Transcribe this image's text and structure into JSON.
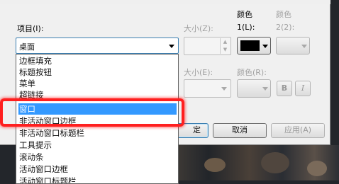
{
  "dialog": {
    "item_label": "项目(I):",
    "item_value": "桌面",
    "size1_label": "大小(Z):",
    "color1_label_line1": "颜色",
    "color1_label_line2": "1(L):",
    "color2_label_line1": "颜色",
    "color2_label_line2": "2(2):",
    "color1_value": "#000000",
    "size2_label": "大小(E):",
    "font_color_label": "颜色(R):",
    "bold_label": "B",
    "italic_label": "I",
    "ok_label": "定",
    "cancel_label": "取消",
    "apply_label": "应用(A)"
  },
  "list": {
    "items": [
      "边框填充",
      "标题按钮",
      "菜单",
      "超链接",
      "窗口",
      "非活动窗口边框",
      "非活动窗口标题栏",
      "工具提示",
      "滚动条",
      "活动窗口边框",
      "活动窗口标题栏"
    ],
    "selected": "窗口"
  }
}
